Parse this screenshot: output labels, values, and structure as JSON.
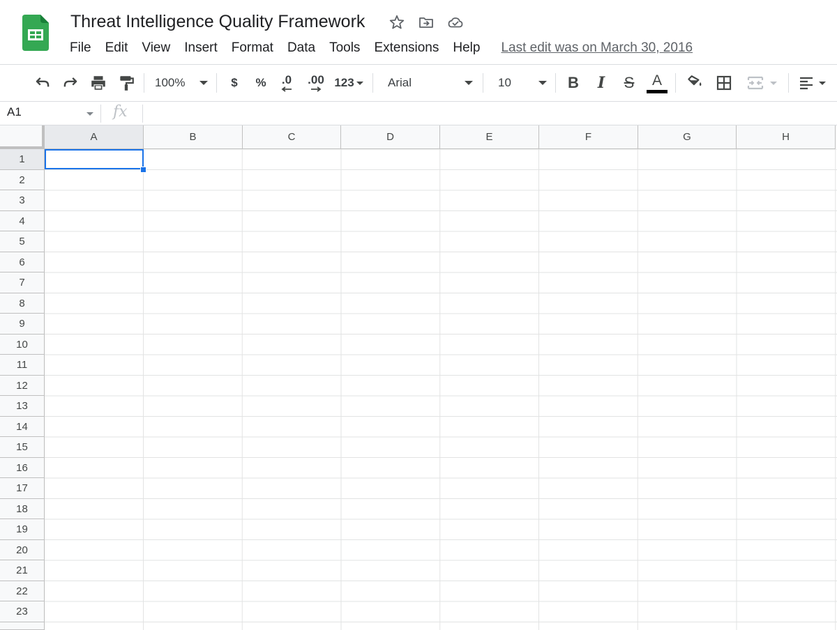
{
  "app": {
    "logo_icon": "google-sheets-logo",
    "document_title": "Threat Intelligence Quality Framework",
    "title_icons": [
      "star-icon",
      "move-to-folder-icon",
      "cloud-status-icon"
    ],
    "last_edit": "Last edit was on March 30, 2016"
  },
  "menu": [
    "File",
    "Edit",
    "View",
    "Insert",
    "Format",
    "Data",
    "Tools",
    "Extensions",
    "Help"
  ],
  "toolbar": {
    "zoom": "100%",
    "currency": "$",
    "percent": "%",
    "decrease_decimal": ".0",
    "increase_decimal": ".00",
    "more_formats": "123",
    "font": "Arial",
    "font_size": "10",
    "bold": "B",
    "italic": "I",
    "strikethrough": "S",
    "text_color": "A",
    "text_color_value": "#000000"
  },
  "formula_bar": {
    "cell_ref": "A1",
    "fx": "fx",
    "value": ""
  },
  "grid": {
    "columns": [
      "A",
      "B",
      "C",
      "D",
      "E",
      "F",
      "G",
      "H"
    ],
    "rows": [
      "1",
      "2",
      "3",
      "4",
      "5",
      "6",
      "7",
      "8",
      "9",
      "10",
      "11",
      "12",
      "13",
      "14",
      "15",
      "16",
      "17",
      "18",
      "19",
      "20",
      "21",
      "22",
      "23"
    ],
    "selected_cell": "A1",
    "selection_color": "#1a73e8"
  }
}
